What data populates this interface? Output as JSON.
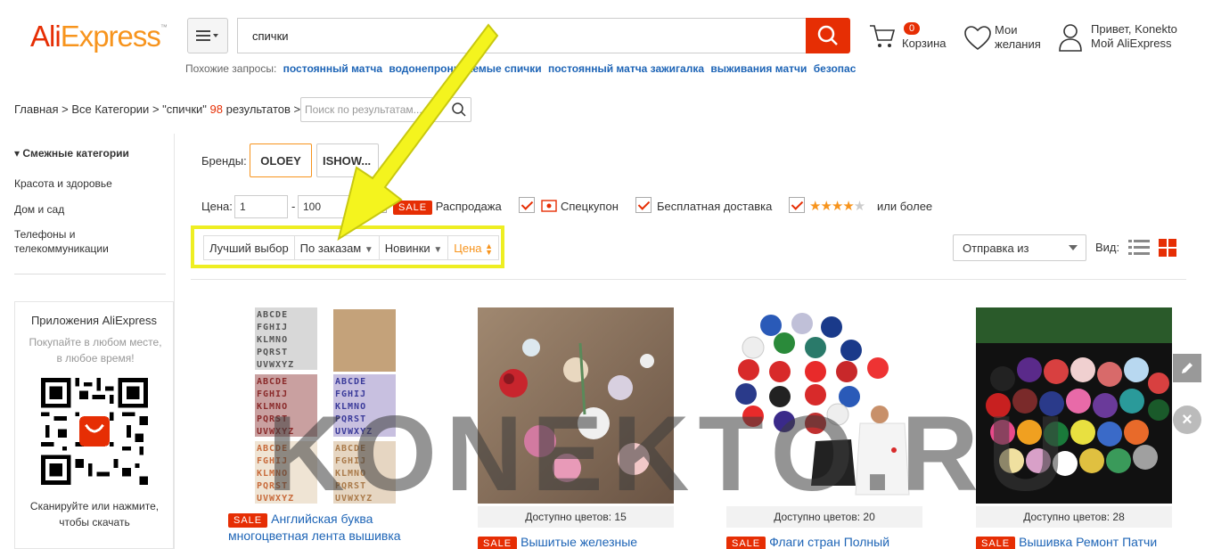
{
  "header": {
    "logo_part1": "Ali",
    "logo_part2": "Express",
    "search_value": "спички",
    "cart_count": "0",
    "cart_label": "Корзина",
    "wishlist_label": "Мои желания",
    "user_greeting": "Привет, Konekto",
    "user_account": "Мой AliExpress"
  },
  "related": {
    "label": "Похожие запросы:",
    "items": [
      "постоянный матча",
      "водонепроницаемые спички",
      "постоянный матча зажигалка",
      "выживания матчи",
      "безопас"
    ]
  },
  "breadcrumb": {
    "home": "Главная",
    "all": "Все Категории",
    "query": "\"спички\"",
    "count": "98",
    "results": "результатов",
    "refine_placeholder": "Поиск по результатам..."
  },
  "sidebar": {
    "title": "Смежные категории",
    "items": [
      "Красота и здоровье",
      "Дом и сад",
      "Телефоны и телекоммуникации"
    ]
  },
  "app_promo": {
    "title": "Приложения AliExpress",
    "subtitle": "Покупайте в любом месте, в любое время!",
    "footer": "Сканируйте или нажмите, чтобы скачать",
    "qr_logo": "AliExpress"
  },
  "filters": {
    "brands_label": "Бренды:",
    "brands": [
      "OLOEY",
      "ISHOW..."
    ],
    "price_label": "Цена:",
    "price_min": "1",
    "price_max": "100",
    "price_dash": "-",
    "sale_tag": "SALE",
    "sale_label": "Распродажа",
    "coupon_label": "Спецкупон",
    "free_shipping_label": "Бесплатная доставка",
    "rating_label": "или более",
    "rating_stars": 4
  },
  "sort": {
    "items": [
      "Лучший выбор",
      "По заказам",
      "Новинки",
      "Цена"
    ],
    "ship_from": "Отправка из",
    "view_label": "Вид:"
  },
  "products": [
    {
      "colors": "",
      "sale": "SALE",
      "title": "Английская буква многоцветная лента вышивка"
    },
    {
      "colors": "Доступно цветов: 15",
      "sale": "SALE",
      "title": "Вышитые железные"
    },
    {
      "colors": "Доступно цветов: 20",
      "sale": "SALE",
      "title": "Флаги стран Полный"
    },
    {
      "colors": "Доступно цветов: 28",
      "sale": "SALE",
      "title": "Вышивка Ремонт Патчи"
    }
  ],
  "product_letters": {
    "row1": "ABCDE",
    "row2": "FGHIJ",
    "row3": "KLMNO",
    "row4": "PQRST",
    "row5": "UVWXYZ"
  },
  "watermark": "KONEKTO.RU",
  "colors": {
    "brand_red": "#e62e04",
    "brand_orange": "#f7941d",
    "link_blue": "#1d64b6",
    "highlight_yellow": "#eeee22"
  }
}
